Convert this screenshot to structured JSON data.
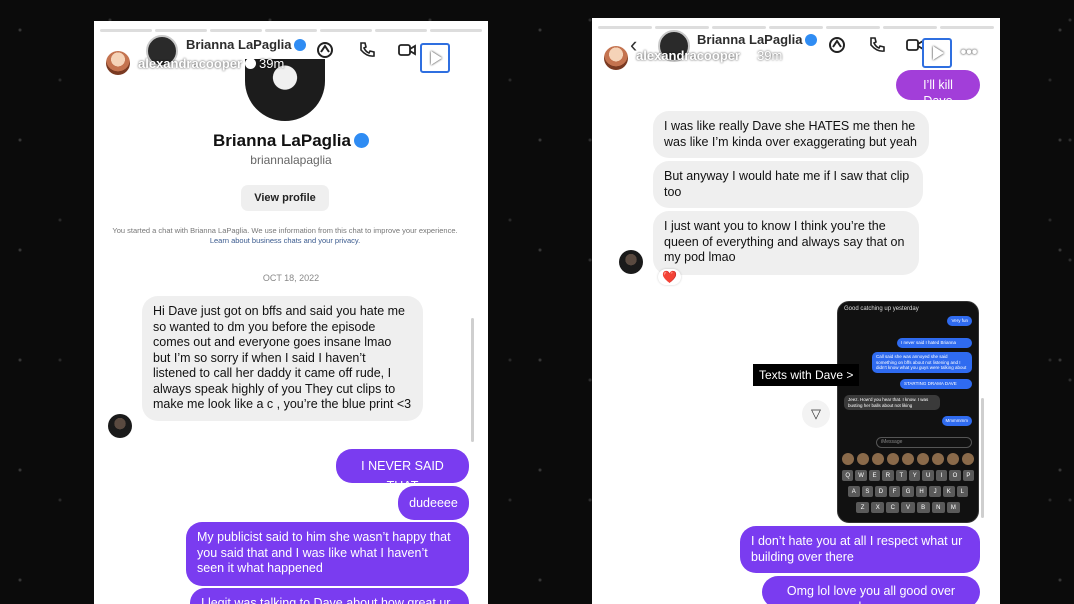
{
  "left": {
    "story_user": "alexandracooper",
    "story_time": "39m",
    "chat_name": "Brianna LaPaglia",
    "profile_name": "Brianna LaPaglia",
    "profile_handle": "briannalapaglia",
    "view_profile": "View profile",
    "disclaimer": "You started a chat with Brianna LaPaglia. We use information from this chat to improve your experience.",
    "disclaimer_link": "Learn about business chats and your privacy.",
    "date": "OCT 18, 2022",
    "messages": [
      {
        "from": "them",
        "text": "Hi Dave just got on bffs and said you hate me so wanted to dm you before the episode comes out and everyone goes insane lmao but I’m so sorry if when I said I haven’t listened to call her daddy it came off rude, I always speak highly of you They cut clips to make me look like a c     , you’re the blue print <3"
      },
      {
        "from": "me",
        "text": "I NEVER SAID THAT"
      },
      {
        "from": "me",
        "text": "dudeeee"
      },
      {
        "from": "me",
        "text": "My publicist said to him she wasn’t happy that you said that and I was like what I haven’t seen it what happened"
      },
      {
        "from": "me",
        "text": "I legit was talking to Dave about how great ur"
      }
    ]
  },
  "right": {
    "story_user": "alexandracooper",
    "story_time": "39m",
    "chat_name": "Brianna LaPaglia",
    "messages": [
      {
        "from": "me",
        "text": "I’ll kill Dave"
      },
      {
        "from": "them",
        "text": "I was like really Dave she HATES me then he was like I’m kinda over exaggerating but yeah"
      },
      {
        "from": "them",
        "text": "But anyway I would hate me if I saw that clip too"
      },
      {
        "from": "them",
        "text": "I just want you to know I think you’re the queen of everything and always say that on my pod lmao"
      },
      {
        "from": "me",
        "text": "I don’t hate you at all I respect what ur building over there"
      },
      {
        "from": "me",
        "text": "Omg lol love you all good over here"
      }
    ],
    "reaction": "❤️",
    "texts_tag": "Texts with Dave >",
    "shot": {
      "top_text": "Good catching up yesterday",
      "bubbles": [
        "Very fun",
        "I never said I hated Brianna",
        "Call said she was annoyed she said something on bffs about not listening and I didn’t know what you guys were talking about",
        "STARTING DRAMA DAVE",
        "Jeez. How’d you hear that. I know. I was busting her balls about not liking",
        "Mmmmmm"
      ],
      "input_placeholder": "iMessage",
      "keys_row1": [
        "Q",
        "W",
        "E",
        "R",
        "T",
        "Y",
        "U",
        "I",
        "O",
        "P"
      ],
      "keys_row2": [
        "A",
        "S",
        "D",
        "F",
        "G",
        "H",
        "J",
        "K",
        "L"
      ],
      "keys_row3": [
        "Z",
        "X",
        "C",
        "V",
        "B",
        "N",
        "M"
      ]
    }
  },
  "icons": {
    "call": "phone-icon",
    "video": "video-icon",
    "more": "more-icon",
    "play": "play-icon"
  }
}
